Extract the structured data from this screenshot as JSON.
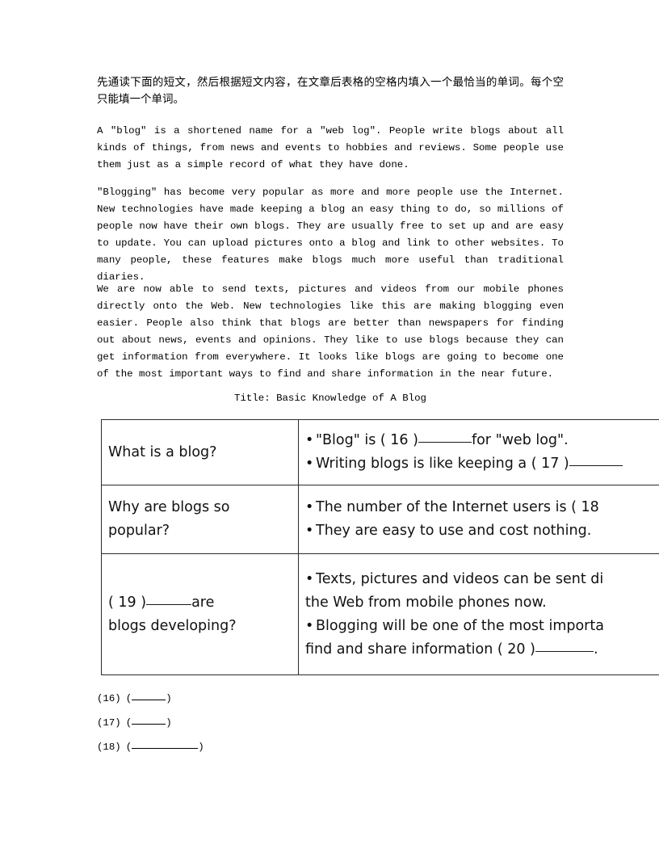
{
  "instruction": {
    "text": "先通读下面的短文，然后根据短文内容，在文章后表格的空格内填入一个最恰当的单词。每个空只能填一个单词。"
  },
  "passage": {
    "paragraph_1": "A \"blog\" is a shortened name for a \"web log\". People write blogs about all kinds of things, from news and events to hobbies and reviews. Some people use them just as a simple record of what they have done.",
    "paragraph_2": "\"Blogging\" has become very popular as more and more people use the Internet. New technologies have made keeping a blog an easy thing to do, so millions of people now have their own blogs. They are usually free to set up and are easy to update. You can upload pictures onto a blog and link to other websites. To many people, these features make blogs much more useful than traditional diaries.",
    "paragraph_3": "We are now able to send texts, pictures and videos from our mobile phones directly onto the Web. New technologies like this are making blogging even easier. People also think that blogs are better than newspapers for finding out about news, events and opinions. They like to use blogs because they can get information from everywhere. It looks like blogs are going to become one of the most important ways to find and share information in the near future."
  },
  "table_title": "Title: Basic Knowledge of A Blog",
  "table": {
    "rows": [
      {
        "question": "What is a blog?",
        "answers": [
          {
            "bullet": "•",
            "pre": "\"Blog\" is ( 16 )",
            "blank": true,
            "post": "for \"web log\"."
          },
          {
            "bullet": "•",
            "pre": "Writing blogs is like keeping a ( 17 )",
            "blank": true,
            "post": ""
          }
        ]
      },
      {
        "question": "Why are blogs so popular?",
        "answers": [
          {
            "bullet": "•",
            "pre": "The number of the Internet users is ( 18",
            "blank": false,
            "post": ""
          },
          {
            "bullet": "•",
            "pre": "They are easy to use and cost nothing.",
            "blank": false,
            "post": ""
          }
        ]
      },
      {
        "question_pre": "( 19 )",
        "question_blank": true,
        "question_post": "are blogs developing?",
        "question": "( 19 ) ______are blogs developing?",
        "answers": [
          {
            "bullet": "•",
            "pre": "Texts, pictures and videos can be sent di",
            "blank": false,
            "post": ""
          },
          {
            "bullet": "",
            "pre": "the Web from mobile phones now.",
            "blank": false,
            "post": ""
          },
          {
            "bullet": "•",
            "pre": "Blogging will be one of the most importa",
            "blank": false,
            "post": ""
          },
          {
            "bullet": "",
            "pre": "find and share information ( 20 )",
            "blank": true,
            "post": "."
          }
        ]
      }
    ]
  },
  "answer_blanks": [
    {
      "number": "(16)",
      "open": "(",
      "close": ")",
      "size": "short"
    },
    {
      "number": "(17)",
      "open": "(",
      "close": ")",
      "size": "short"
    },
    {
      "number": "(18)",
      "open": "(",
      "close": ")",
      "size": "long"
    }
  ]
}
